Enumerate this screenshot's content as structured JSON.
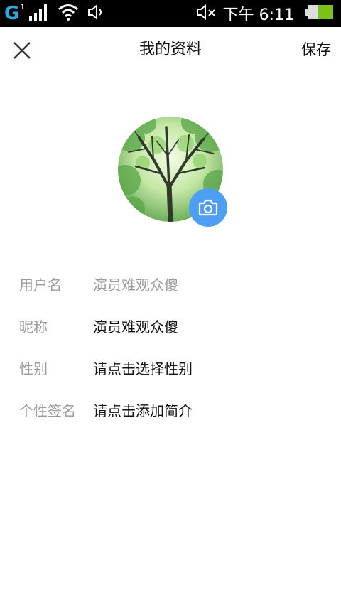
{
  "status_bar": {
    "network_type": "G",
    "sim_index": "1",
    "time": "下午 6:11"
  },
  "header": {
    "title": "我的资料",
    "save_label": "保存"
  },
  "profile": {
    "fields": [
      {
        "label": "用户名",
        "value": "演员难观众傻",
        "muted": true
      },
      {
        "label": "昵称",
        "value": "演员难观众傻",
        "muted": false
      },
      {
        "label": "性别",
        "value": "请点击选择性别",
        "muted": false
      },
      {
        "label": "个性签名",
        "value": "请点击添加简介",
        "muted": false
      }
    ]
  },
  "colors": {
    "accent_blue": "#4d9ff4",
    "network_blue": "#2aa9e0",
    "battery_green": "#7cc11a"
  }
}
